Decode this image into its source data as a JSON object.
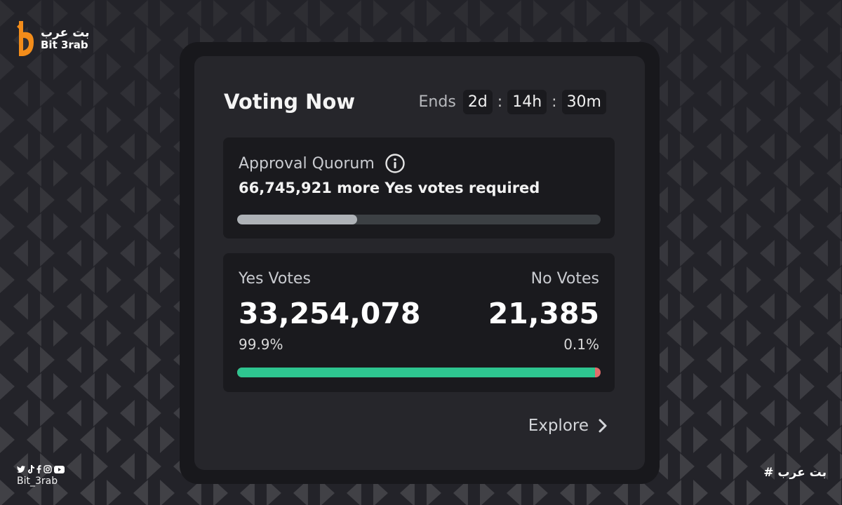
{
  "brand": {
    "arabic": "بت عرب",
    "latin": "Bit 3rab",
    "accent": "#f28c1a"
  },
  "social": {
    "handle": "Bit_3rab",
    "icons": [
      "twitter-icon",
      "tiktok-icon",
      "facebook-icon",
      "instagram-icon",
      "youtube-icon"
    ]
  },
  "hashtag": "# بت عرب",
  "card": {
    "title": "Voting Now",
    "ends_label": "Ends",
    "countdown": {
      "days": "2d",
      "hours": "14h",
      "minutes": "30m"
    }
  },
  "quorum": {
    "label": "Approval Quorum",
    "required_text": "66,745,921 more Yes votes required",
    "progress_fraction": 0.33
  },
  "votes": {
    "yes_label": "Yes Votes",
    "yes_count": "33,254,078",
    "yes_percent": "99.9%",
    "no_label": "No Votes",
    "no_count": "21,385",
    "no_percent": "0.1%",
    "yes_fraction": 0.985,
    "colors": {
      "yes": "#2ec590",
      "no": "#e26b6b"
    }
  },
  "explore_label": "Explore"
}
